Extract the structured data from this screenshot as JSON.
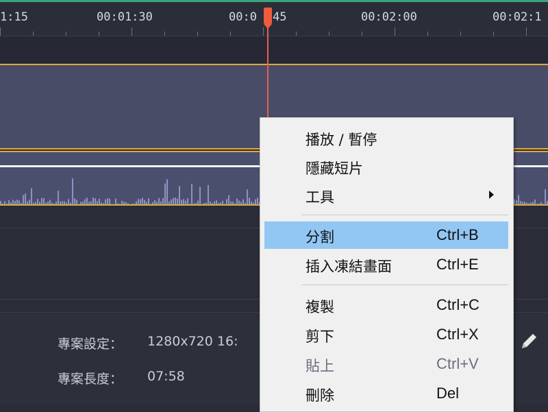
{
  "timeline": {
    "ticks": [
      {
        "label": "1:15"
      },
      {
        "label": "00:01:30"
      },
      {
        "label": "00:0"
      },
      {
        "label": "45"
      },
      {
        "label": "00:02:00"
      },
      {
        "label": "00:02:1"
      }
    ]
  },
  "project_info": {
    "settings_label": "專案設定：",
    "settings_value": "1280x720 16:",
    "length_label": "專案長度：",
    "length_value": "07:58"
  },
  "context_menu": {
    "items": [
      {
        "label": "播放 / 暫停",
        "shortcut": ""
      },
      {
        "label": "隱藏短片",
        "shortcut": ""
      },
      {
        "label": "工具",
        "shortcut": ""
      },
      {
        "label": "分割",
        "shortcut": "Ctrl+B"
      },
      {
        "label": "插入凍結畫面",
        "shortcut": "Ctrl+E"
      },
      {
        "label": "複製",
        "shortcut": "Ctrl+C"
      },
      {
        "label": "剪下",
        "shortcut": "Ctrl+X"
      },
      {
        "label": "貼上",
        "shortcut": "Ctrl+V"
      },
      {
        "label": "刪除",
        "shortcut": "Del"
      }
    ]
  },
  "colors": {
    "accent_highlight": "#92c7f4",
    "playhead": "#f05a3e",
    "track_border": "#e0a93c",
    "video_clip": "#494c67"
  },
  "icons": {
    "edit": "pencil-icon",
    "submenu": "chevron-right-icon"
  }
}
